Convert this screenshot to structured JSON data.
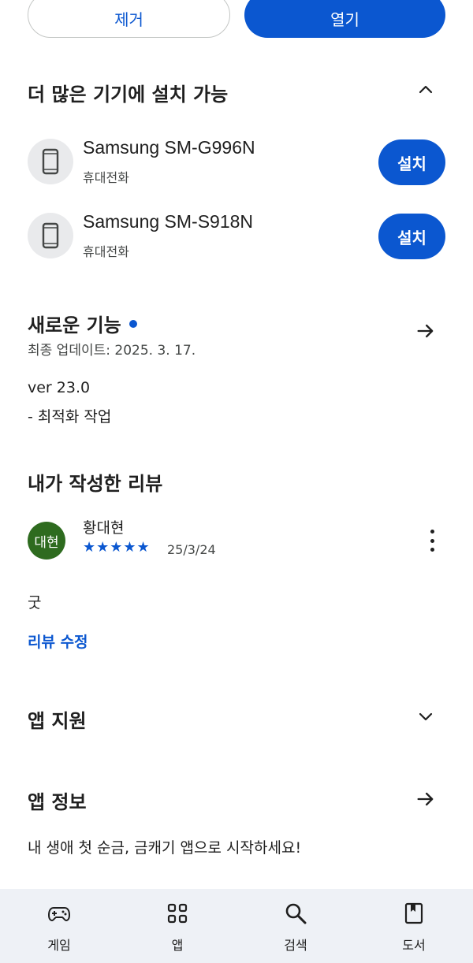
{
  "actions": {
    "remove_label": "제거",
    "open_label": "열기"
  },
  "devices_section": {
    "title": "더 많은 기기에 설치 가능",
    "devices": [
      {
        "name": "Samsung SM-G996N",
        "type": "휴대전화",
        "install_label": "설치"
      },
      {
        "name": "Samsung SM-S918N",
        "type": "휴대전화",
        "install_label": "설치"
      }
    ]
  },
  "whats_new": {
    "title": "새로운 기능",
    "updated": "최종 업데이트: 2025. 3. 17.",
    "version": "ver 23.0",
    "notes": "- 최적화 작업"
  },
  "my_review": {
    "title": "내가 작성한 리뷰",
    "avatar_text": "대현",
    "reviewer": "황대현",
    "stars": "★★★★★",
    "rating": 5,
    "date": "25/3/24",
    "text": "굿",
    "edit_label": "리뷰 수정"
  },
  "app_support": {
    "title": "앱 지원"
  },
  "app_info": {
    "title": "앱 정보",
    "description": "내 생애 첫 순금, 금캐기 앱으로 시작하세요!"
  },
  "bottom_nav": [
    {
      "label": "게임",
      "icon": "gamepad-icon"
    },
    {
      "label": "앱",
      "icon": "apps-grid-icon"
    },
    {
      "label": "검색",
      "icon": "search-icon"
    },
    {
      "label": "도서",
      "icon": "book-icon"
    }
  ],
  "colors": {
    "accent": "#0b57d0",
    "avatar_bg": "#2e6b1f",
    "nav_bg": "#eef1f6"
  }
}
